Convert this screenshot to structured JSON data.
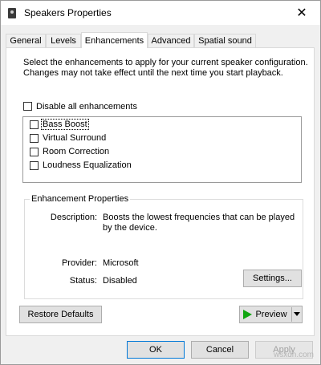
{
  "window": {
    "title": "Speakers Properties"
  },
  "tabs": [
    {
      "label": "General"
    },
    {
      "label": "Levels"
    },
    {
      "label": "Enhancements",
      "active": true
    },
    {
      "label": "Advanced"
    },
    {
      "label": "Spatial sound"
    }
  ],
  "panel": {
    "intro": "Select the enhancements to apply for your current speaker configuration. Changes may not take effect until the next time you start playback.",
    "disable_all_label": "Disable all enhancements",
    "enhancements": [
      {
        "label": "Bass Boost",
        "checked": false,
        "focused": true
      },
      {
        "label": "Virtual Surround",
        "checked": false
      },
      {
        "label": "Room Correction",
        "checked": false
      },
      {
        "label": "Loudness Equalization",
        "checked": false
      }
    ],
    "properties": {
      "group_title": "Enhancement Properties",
      "description_label": "Description:",
      "description_value": "Boosts the lowest frequencies that can be played by the device.",
      "provider_label": "Provider:",
      "provider_value": "Microsoft",
      "status_label": "Status:",
      "status_value": "Disabled",
      "settings_label": "Settings..."
    },
    "restore_defaults_label": "Restore Defaults",
    "preview_label": "Preview"
  },
  "footer": {
    "ok_label": "OK",
    "cancel_label": "Cancel",
    "apply_label": "Apply"
  },
  "watermark": "wsxdn.com",
  "colors": {
    "accent_border": "#0078d7",
    "play_green": "#11a611"
  }
}
